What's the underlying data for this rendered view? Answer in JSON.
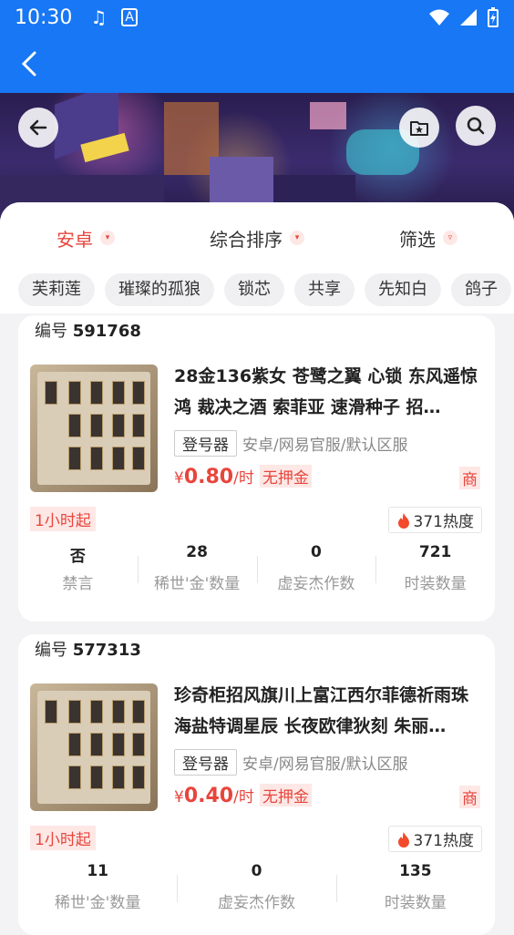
{
  "status_bar": {
    "time": "10:30"
  },
  "filters": [
    {
      "label": "安卓",
      "active": true
    },
    {
      "label": "综合排序",
      "active": false
    },
    {
      "label": "筛选",
      "active": false
    }
  ],
  "tags": [
    "芙莉莲",
    "璀璨的孤狼",
    "锁芯",
    "共享",
    "先知白",
    "鸽子"
  ],
  "cards": [
    {
      "id_label": "编号",
      "id": "591768",
      "title": "28金136紫女 苍鹭之翼 心锁 东风遥惊鸿 裁决之酒 索菲亚 速滑种子 招…",
      "login": "登号器",
      "platform": "安卓/网易官服/默认区服",
      "price_symbol": "¥",
      "price": "0.80",
      "unit": "/时",
      "no_deposit": "无押金",
      "merchant": "商",
      "min_rent": "1小时起",
      "heat": "371热度",
      "stats": [
        {
          "value": "否",
          "label": "禁言"
        },
        {
          "value": "28",
          "label": "稀世'金'数量"
        },
        {
          "value": "0",
          "label": "虚妄杰作数"
        },
        {
          "value": "721",
          "label": "时装数量"
        }
      ]
    },
    {
      "id_label": "编号",
      "id": "577313",
      "title": "珍奇柜招风旗川上富江西尔菲德祈雨珠海盐特调星辰 长夜欧律狄刻 朱丽…",
      "login": "登号器",
      "platform": "安卓/网易官服/默认区服",
      "price_symbol": "¥",
      "price": "0.40",
      "unit": "/时",
      "no_deposit": "无押金",
      "merchant": "商",
      "min_rent": "1小时起",
      "heat": "371热度",
      "stats": [
        {
          "value": "11",
          "label": "稀世'金'数量"
        },
        {
          "value": "0",
          "label": "虚妄杰作数"
        },
        {
          "value": "135",
          "label": "时装数量"
        }
      ]
    }
  ],
  "colors": {
    "primary": "#1777f5",
    "accent": "#e8453c"
  }
}
